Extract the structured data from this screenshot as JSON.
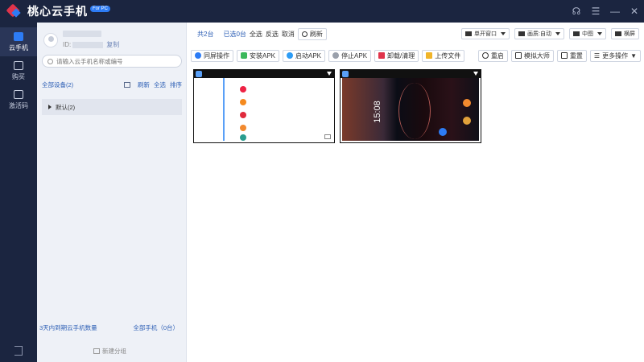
{
  "app": {
    "title": "桃心云手机",
    "badge": "For PC"
  },
  "nav": {
    "items": [
      {
        "label": "云手机",
        "active": true
      },
      {
        "label": "购买",
        "active": false
      },
      {
        "label": "激活码",
        "active": false
      }
    ]
  },
  "sidebar": {
    "user": {
      "id_label": "ID:",
      "copy_label": "复制"
    },
    "search_placeholder": "请输入云手机名称或编号",
    "devices_label": "全部设备(2)",
    "actions": {
      "refresh": "刷新",
      "select_all": "全选",
      "sort": "排序"
    },
    "groups": [
      {
        "label": "默认(2)"
      }
    ],
    "footer": {
      "expiring": "3天内到期云手机数量",
      "all_phones": "全部手机（0台）",
      "new_group": "新建分组"
    }
  },
  "main": {
    "toolbar1": {
      "total": "共2台",
      "selected": "已选0台",
      "select_all": "全选",
      "invert": "反选",
      "cancel": "取消",
      "refresh": "刷新",
      "window_mode": "单开窗口",
      "quality": "画质:自动",
      "size": "中图",
      "orientation": "横屏"
    },
    "toolbar2": {
      "sync": "同屏操作",
      "install": "安装APK",
      "launch": "启动APK",
      "stop": "停止APK",
      "uninstall": "卸载/清理",
      "upload": "上传文件",
      "reboot": "重启",
      "simulator": "模拟大师",
      "reset": "重置",
      "more": "更多操作"
    },
    "phones": [
      {
        "screen": "app-list"
      },
      {
        "screen": "lockscreen",
        "clock": "15:08"
      }
    ]
  },
  "colors": {
    "nav_bg": "#1b2540",
    "accent": "#2d7cf5",
    "brand_red": "#e0344b",
    "link": "#2d5fb5"
  }
}
